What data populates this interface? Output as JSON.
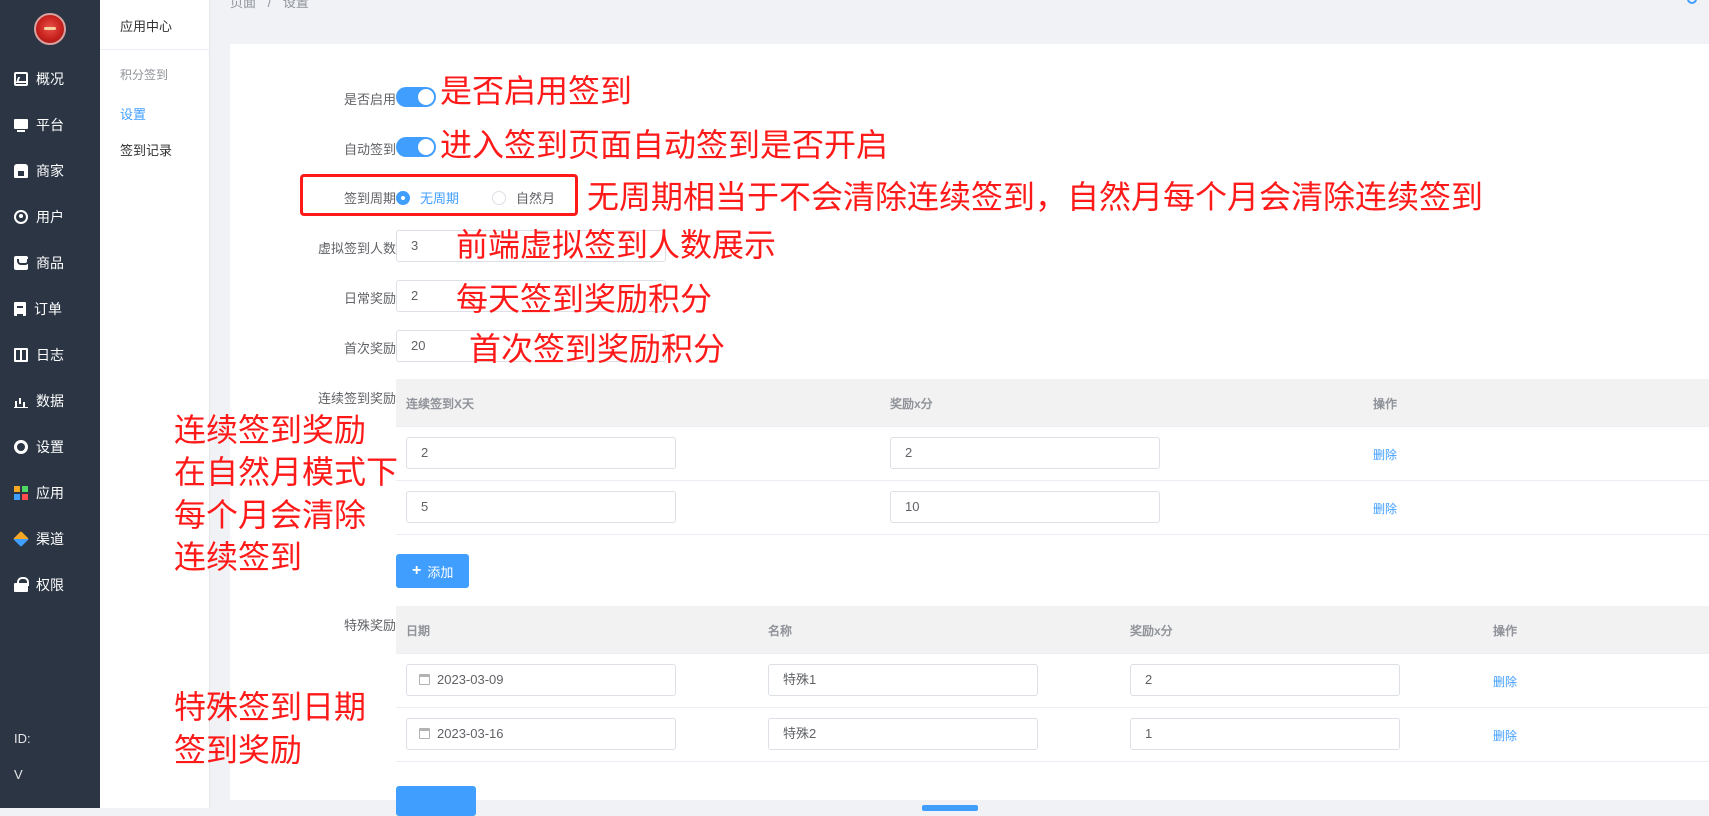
{
  "sidebar": {
    "items": [
      {
        "label": "概况",
        "icon": "dashboard-icon"
      },
      {
        "label": "平台",
        "icon": "monitor-icon"
      },
      {
        "label": "商家",
        "icon": "shop-icon"
      },
      {
        "label": "用户",
        "icon": "user-icon"
      },
      {
        "label": "商品",
        "icon": "goods-icon"
      },
      {
        "label": "订单",
        "icon": "order-icon"
      },
      {
        "label": "日志",
        "icon": "log-icon"
      },
      {
        "label": "数据",
        "icon": "data-icon"
      },
      {
        "label": "设置",
        "icon": "gear-icon"
      },
      {
        "label": "应用",
        "icon": "apps-icon"
      },
      {
        "label": "渠道",
        "icon": "cube-icon"
      },
      {
        "label": "权限",
        "icon": "lock-icon"
      }
    ],
    "footer_id": "ID:",
    "footer_v": "V"
  },
  "submenu": {
    "title": "应用中心",
    "group": "积分签到",
    "items": [
      "设置",
      "签到记录"
    ],
    "active": "设置"
  },
  "breadcrumb": {
    "parent": "页面",
    "sep": "/",
    "current": "设置"
  },
  "form": {
    "enable_label": "是否启用",
    "enable_on": true,
    "auto_label": "自动签到",
    "auto_on": true,
    "cycle_label": "签到周期",
    "cycle_options": [
      "无周期",
      "自然月"
    ],
    "cycle_selected": "无周期",
    "virtual_label": "虚拟签到人数",
    "virtual_value": "3",
    "daily_label": "日常奖励",
    "daily_value": "2",
    "first_label": "首次奖励",
    "first_value": "20",
    "continuous_label": "连续签到奖励",
    "special_label": "特殊奖励"
  },
  "continuous_table": {
    "headers": [
      "连续签到X天",
      "奖励x分",
      "操作"
    ],
    "rows": [
      {
        "days": "2",
        "points": "2",
        "action": "删除"
      },
      {
        "days": "5",
        "points": "10",
        "action": "删除"
      }
    ],
    "add_label": "添加"
  },
  "special_table": {
    "headers": [
      "日期",
      "名称",
      "奖励x分",
      "操作"
    ],
    "rows": [
      {
        "date": "2023-03-09",
        "name": "特殊1",
        "points": "2",
        "action": "删除"
      },
      {
        "date": "2023-03-16",
        "name": "特殊2",
        "points": "1",
        "action": "删除"
      }
    ]
  },
  "annotations": {
    "enable": "是否启用签到",
    "auto": "进入签到页面自动签到是否开启",
    "cycle": "无周期相当于不会清除连续签到，自然月每个月会清除连续签到",
    "virtual": "前端虚拟签到人数展示",
    "daily": "每天签到奖励积分",
    "first": "首次签到奖励积分",
    "continuous_1": "连续签到奖励",
    "continuous_2": "在自然月模式下",
    "continuous_3": "每个月会清除",
    "continuous_4": "连续签到",
    "special_1": "特殊签到日期",
    "special_2": "签到奖励",
    "color": "#ff1a1a"
  },
  "colors": {
    "accent": "#409eff",
    "sidebar_bg": "#2b3544"
  }
}
